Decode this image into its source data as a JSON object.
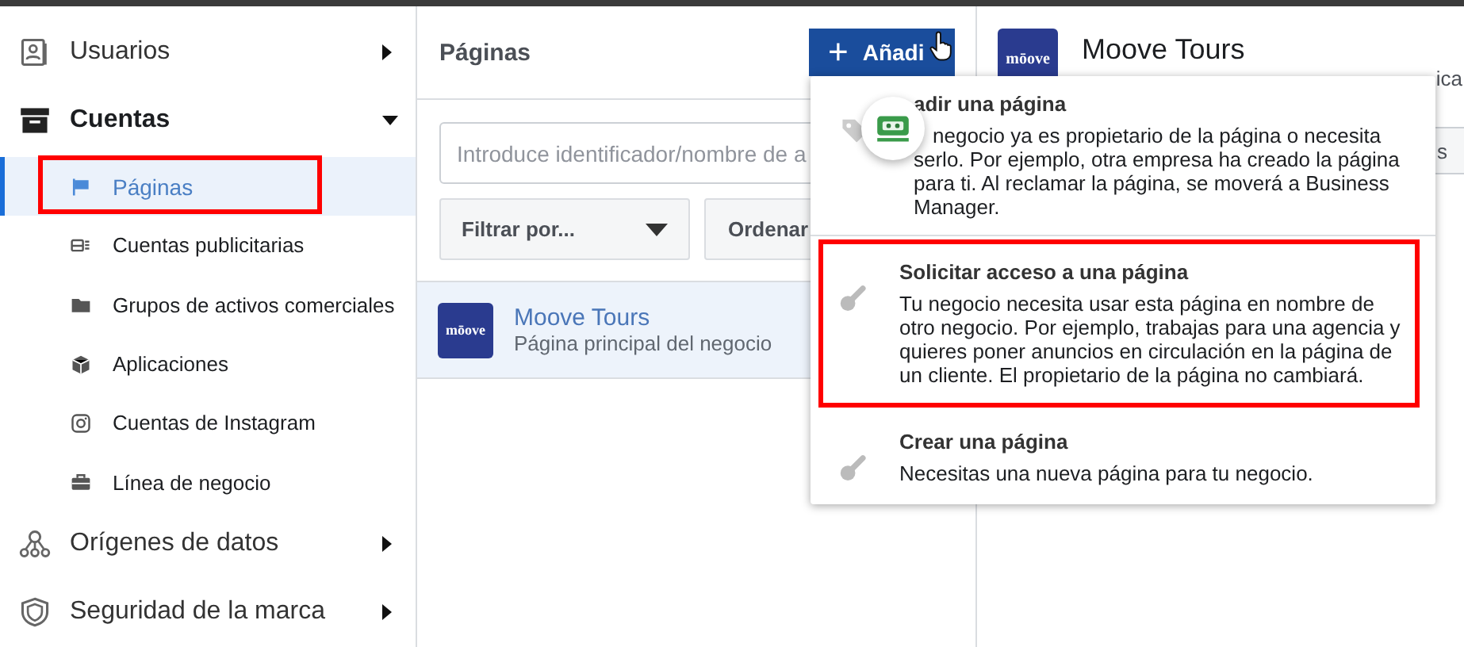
{
  "sidebar": {
    "sections": [
      {
        "label": "Usuarios",
        "expanded": false
      },
      {
        "label": "Cuentas",
        "expanded": true,
        "children": [
          {
            "label": "Páginas",
            "selected": true,
            "annotated": true
          },
          {
            "label": "Cuentas publicitarias",
            "selected": false,
            "annotated": false
          },
          {
            "label": "Grupos de activos comerciales",
            "selected": false,
            "annotated": false
          },
          {
            "label": "Aplicaciones",
            "selected": false,
            "annotated": false
          },
          {
            "label": "Cuentas de Instagram",
            "selected": false,
            "annotated": false
          },
          {
            "label": "Línea de negocio",
            "selected": false,
            "annotated": false
          }
        ]
      },
      {
        "label": "Orígenes de datos",
        "expanded": false
      },
      {
        "label": "Seguridad de la marca",
        "expanded": false
      }
    ]
  },
  "pages_panel": {
    "title": "Páginas",
    "add_button": "Añadi",
    "add_icon": "+",
    "search": {
      "placeholder": "Introduce identificador/nombre de a"
    },
    "filter": "Filtrar por...",
    "sort": "Ordenar",
    "rows": [
      {
        "logo": "mōove",
        "name": "Moove Tours",
        "subtitle": "Página principal del negocio",
        "selected": true
      }
    ]
  },
  "detail": {
    "logo": "mōove",
    "name": "Moove Tours",
    "subtitle": "ica",
    "button": "s"
  },
  "add_menu": {
    "items": [
      {
        "title": "adir una página",
        "description": "negocio ya es propietario de la página o necesita serlo. Por ejemplo, otra empresa ha creado la página para ti. Al reclamar la página, se moverá a Business Manager.",
        "annotated": false
      },
      {
        "title": "Solicitar acceso a una página",
        "description": "Tu negocio necesita usar esta página en nombre de otro negocio. Por ejemplo, trabajas para una agencia y quieres poner anuncios en circulación en la página de un cliente. El propietario de la página no cambiará.",
        "annotated": true
      },
      {
        "title": "Crear una página",
        "description": "Necesitas una nueva página para tu negocio.",
        "annotated": false
      }
    ]
  }
}
